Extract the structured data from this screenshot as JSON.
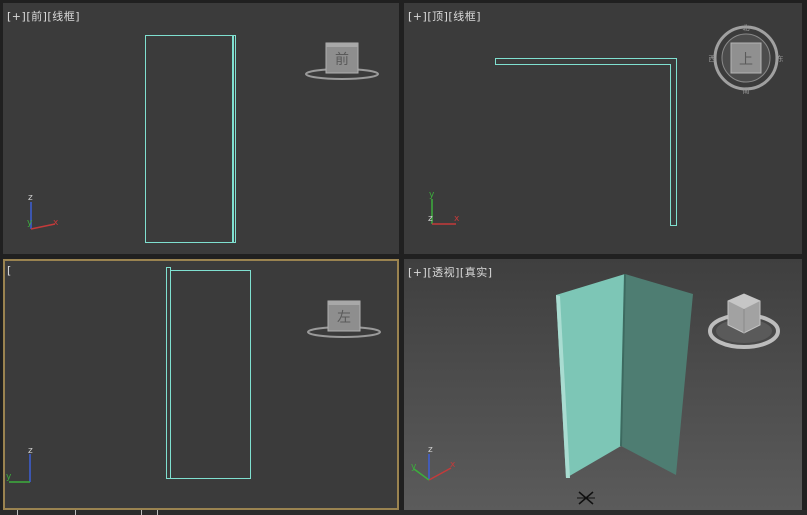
{
  "viewports": {
    "front": {
      "bracket_plus": "[+]",
      "bracket_view": "[前]",
      "bracket_mode": "[线框]",
      "viewcube_face": "前"
    },
    "top": {
      "bracket_plus": "[+]",
      "bracket_view": "[顶]",
      "bracket_mode": "[线框]",
      "viewcube_face": "上"
    },
    "left": {
      "bracket_plus": "[",
      "viewcube_face": "左"
    },
    "perspective": {
      "bracket_plus": "[+]",
      "bracket_view": "[透视]",
      "bracket_mode": "[真实]"
    }
  },
  "axis": {
    "x": "x",
    "y": "y",
    "z": "z"
  },
  "colors": {
    "viewport_bg": "#3b3b3b",
    "wireframe": "#7fe0d0",
    "active_border": "#9a8350",
    "axis_x": "#c43a3a",
    "axis_y": "#3cae3c",
    "axis_z": "#3d5fd8",
    "object_face_light": "#7dc6b6",
    "object_face_dark": "#4e7d72"
  }
}
